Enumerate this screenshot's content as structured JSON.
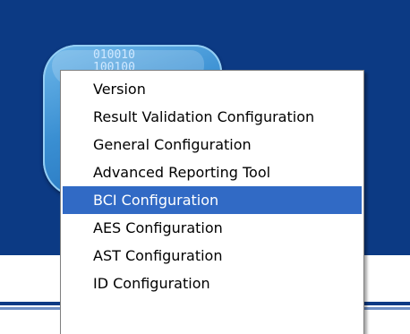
{
  "icon": {
    "binary_line_1": "010010",
    "binary_line_2": "100100"
  },
  "context_menu": {
    "items": [
      {
        "label": "Version",
        "selected": false
      },
      {
        "label": "Result Validation Configuration",
        "selected": false
      },
      {
        "label": "General Configuration",
        "selected": false
      },
      {
        "label": "Advanced Reporting Tool",
        "selected": false
      },
      {
        "label": "BCI Configuration",
        "selected": true
      },
      {
        "label": "AES Configuration",
        "selected": false
      },
      {
        "label": "AST Configuration",
        "selected": false
      },
      {
        "label": "ID Configuration",
        "selected": false
      }
    ],
    "highlight_color": "#316ac5"
  },
  "colors": {
    "desktop_blue": "#0c3a84",
    "icon_blue": "#3a8fd2"
  }
}
